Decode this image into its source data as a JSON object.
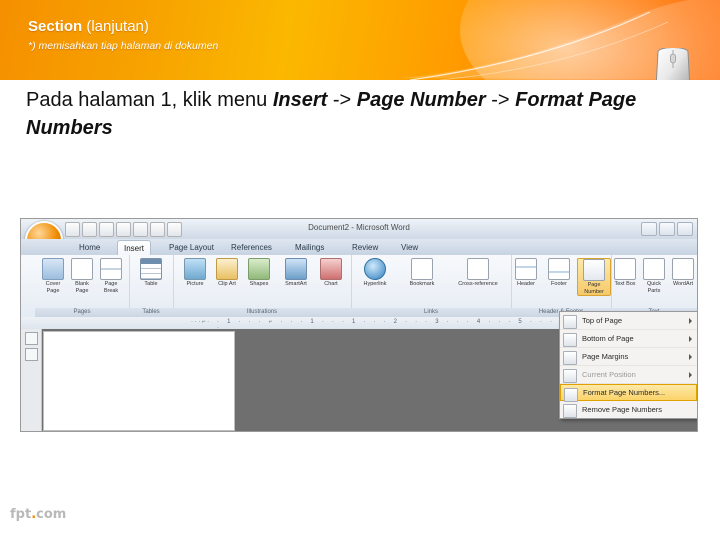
{
  "header": {
    "title_bold": "Section",
    "title_rest": "(lanjutan)",
    "subtitle": "*) memisahkan tiap halaman di dokumen"
  },
  "lead": {
    "part1": "Pada halaman 1, klik menu ",
    "em1": "Insert",
    "part2": " -> ",
    "em2": "Page Number",
    "part3": " -> ",
    "em3": "Format Page Numbers"
  },
  "word": {
    "document_title": "Document2 - Microsoft Word",
    "tabs": [
      {
        "label": "Home",
        "active": false
      },
      {
        "label": "Insert",
        "active": true
      },
      {
        "label": "Page Layout",
        "active": false
      },
      {
        "label": "References",
        "active": false
      },
      {
        "label": "Mailings",
        "active": false
      },
      {
        "label": "Review",
        "active": false
      },
      {
        "label": "View",
        "active": false
      }
    ],
    "groups": [
      {
        "label": "Pages",
        "buttons": [
          {
            "label": "Cover Page",
            "icon": "cover-page-icon",
            "color": "#d8e6f5"
          },
          {
            "label": "Blank Page",
            "icon": "blank-page-icon",
            "color": "#eef2f7"
          },
          {
            "label": "Page Break",
            "icon": "page-break-icon",
            "color": "#e6ebf2"
          }
        ]
      },
      {
        "label": "Tables",
        "buttons": [
          {
            "label": "Table",
            "icon": "table-icon",
            "color": "#cfd9e6"
          }
        ]
      },
      {
        "label": "Illustrations",
        "buttons": [
          {
            "label": "Picture",
            "icon": "picture-icon",
            "color": "#9bc4e2"
          },
          {
            "label": "Clip Art",
            "icon": "clip-art-icon",
            "color": "#f3d9a0"
          },
          {
            "label": "Shapes",
            "icon": "shapes-icon",
            "color": "#b9d7a8"
          },
          {
            "label": "SmartArt",
            "icon": "smartart-icon",
            "color": "#8fb8dd"
          },
          {
            "label": "Chart",
            "icon": "chart-icon",
            "color": "#e2a0a0"
          }
        ]
      },
      {
        "label": "Links",
        "buttons": [
          {
            "label": "Hyperlink",
            "icon": "hyperlink-icon",
            "color": "#7fb6dd"
          },
          {
            "label": "Bookmark",
            "icon": "bookmark-icon",
            "color": "#e8edf3"
          },
          {
            "label": "Cross-reference",
            "icon": "cross-reference-icon",
            "color": "#e8edf3"
          }
        ]
      },
      {
        "label": "Header & Footer",
        "buttons": [
          {
            "label": "Header",
            "icon": "header-icon",
            "color": "#dfe8f2"
          },
          {
            "label": "Footer",
            "icon": "footer-icon",
            "color": "#dfe8f2"
          },
          {
            "label": "Page Number",
            "icon": "page-number-icon",
            "color": "#fbdf9c"
          }
        ]
      },
      {
        "label": "Text",
        "buttons": [
          {
            "label": "Text Box",
            "icon": "text-box-icon",
            "color": "#e8edf3"
          },
          {
            "label": "Quick Parts",
            "icon": "quick-parts-icon",
            "color": "#e8edf3"
          },
          {
            "label": "WordArt",
            "icon": "wordart-icon",
            "color": "#e8edf3"
          }
        ]
      }
    ],
    "ruler_marks": "· 1 · · · ⌐ · · · 1 · · · 1 · · · 2 · · · 3 · · · 4 · · · 5 · · · 6 · · · 7 · · · 8 · · · 9 ·",
    "ruler_left": "·  ·  ·  ⌐  ·",
    "page_number_menu": [
      {
        "label": "Top of Page",
        "icon": "top-of-page-icon",
        "submenu": true,
        "state": "normal"
      },
      {
        "label": "Bottom of Page",
        "icon": "bottom-of-page-icon",
        "submenu": true,
        "state": "normal"
      },
      {
        "label": "Page Margins",
        "icon": "page-margins-icon",
        "submenu": true,
        "state": "normal"
      },
      {
        "label": "Current Position",
        "icon": "current-position-icon",
        "submenu": true,
        "state": "disabled"
      },
      {
        "label": "Format Page Numbers...",
        "icon": "format-page-numbers-icon",
        "submenu": false,
        "state": "highlight"
      },
      {
        "label": "Remove Page Numbers",
        "icon": "remove-page-numbers-icon",
        "submenu": false,
        "state": "normal"
      }
    ]
  },
  "footer": {
    "brand": "fpt",
    "dot": ".",
    "suffix": "com"
  }
}
